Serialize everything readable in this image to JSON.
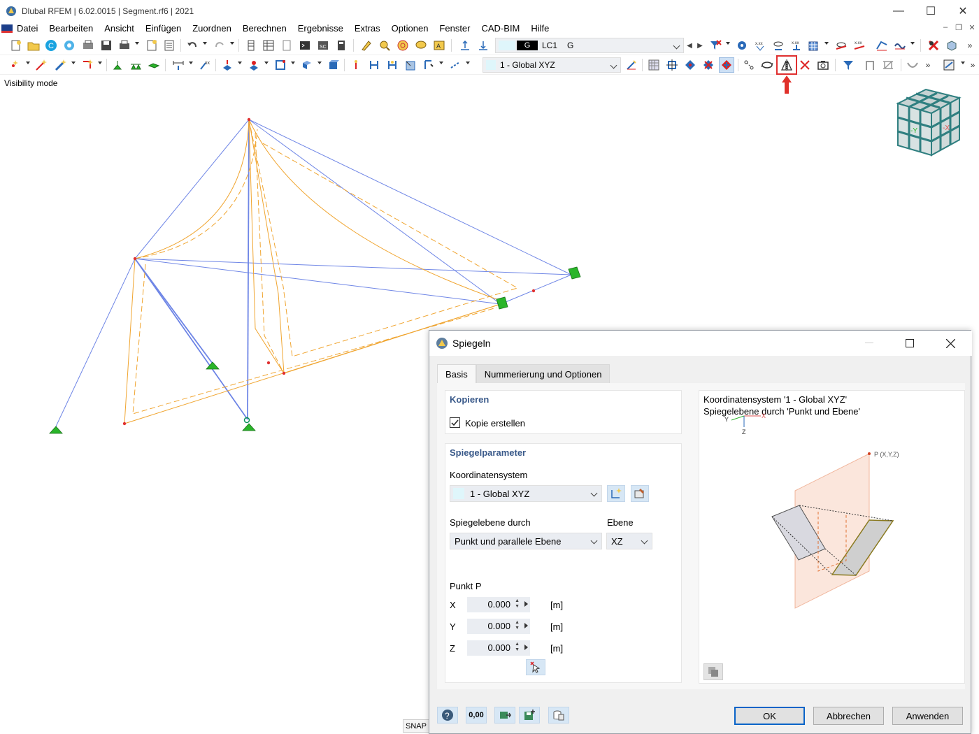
{
  "window": {
    "title": "Dlubal RFEM | 6.02.0015 | Segment.rf6 | 2021",
    "minimize": "—",
    "maximize": "☐",
    "close": "✕"
  },
  "menu": [
    "Datei",
    "Bearbeiten",
    "Ansicht",
    "Einfügen",
    "Zuordnen",
    "Berechnen",
    "Ergebnisse",
    "Extras",
    "Optionen",
    "Fenster",
    "CAD-BIM",
    "Hilfe"
  ],
  "mdi": {
    "minimize": "–",
    "restore": "❐",
    "close": "✕"
  },
  "toolbar1": {
    "load_type": "G",
    "load_case": "LC1",
    "load_name": "G",
    "more": "»"
  },
  "toolbar2": {
    "coord_system": "1 - Global XYZ",
    "more": "»"
  },
  "viewport": {
    "mode_label": "Visibility mode",
    "cube_y": "-Y",
    "cube_x": "-X"
  },
  "status": {
    "snap": "SNAP"
  },
  "dialog": {
    "title": "Spiegeln",
    "tabs": [
      "Basis",
      "Nummerierung und Optionen"
    ],
    "copy_group": {
      "heading": "Kopieren",
      "checkbox_label": "Kopie erstellen",
      "checked": true
    },
    "params_group": {
      "heading": "Spiegelparameter",
      "coord_label": "Koordinatensystem",
      "coord_value": "1 - Global XYZ",
      "plane_label": "Spiegelebene durch",
      "plane_value": "Punkt und parallele Ebene",
      "ebene_label": "Ebene",
      "ebene_value": "XZ",
      "point_label": "Punkt P",
      "x_label": "X",
      "x_value": "0.000",
      "y_label": "Y",
      "y_value": "0.000",
      "z_label": "Z",
      "z_value": "0.000",
      "unit": "[m]"
    },
    "preview": {
      "line1": "Koordinatensystem '1 - Global XYZ'",
      "line2": "Spiegelebene durch 'Punkt und Ebene'",
      "point_label": "P (X,Y,Z)",
      "axis_y": "Y",
      "axis_x": "X",
      "axis_z": "Z"
    },
    "footer_value_icon": "0,00",
    "buttons": {
      "ok": "OK",
      "cancel": "Abbrechen",
      "apply": "Anwenden"
    }
  }
}
